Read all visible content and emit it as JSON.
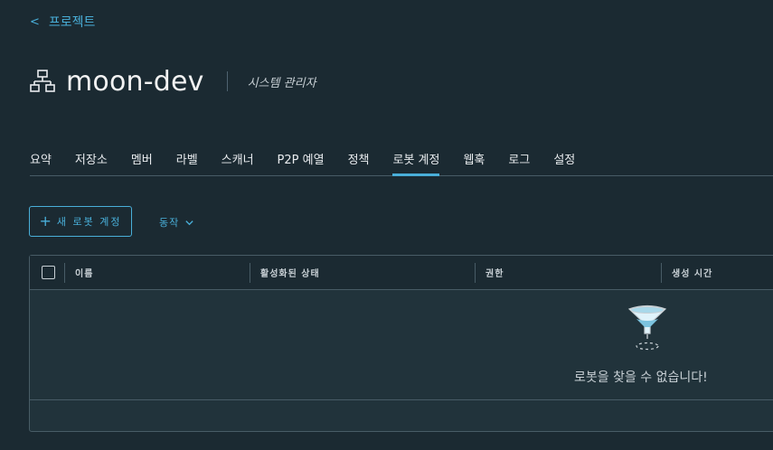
{
  "breadcrumb": {
    "label": "프로젝트",
    "chevron": "<"
  },
  "project": {
    "name": "moon-dev",
    "role": "시스템 관리자",
    "icon": "project-icon"
  },
  "tabs": [
    {
      "label": "요약"
    },
    {
      "label": "저장소"
    },
    {
      "label": "멤버"
    },
    {
      "label": "라벨"
    },
    {
      "label": "스캐너"
    },
    {
      "label": "P2P 예열"
    },
    {
      "label": "정책"
    },
    {
      "label": "로봇 계정",
      "active": true
    },
    {
      "label": "웹훅"
    },
    {
      "label": "로그"
    },
    {
      "label": "설정"
    }
  ],
  "toolbar": {
    "add_robot_label": "새 로봇 계정",
    "actions_label": "동작"
  },
  "grid": {
    "columns": [
      "이름",
      "활성화된 상태",
      "권한",
      "생성 시간"
    ],
    "empty_message": "로봇을 찾을 수 없습니다!"
  },
  "colors": {
    "accent": "#49afd9",
    "background": "#1b2a32",
    "border": "#485c66"
  }
}
